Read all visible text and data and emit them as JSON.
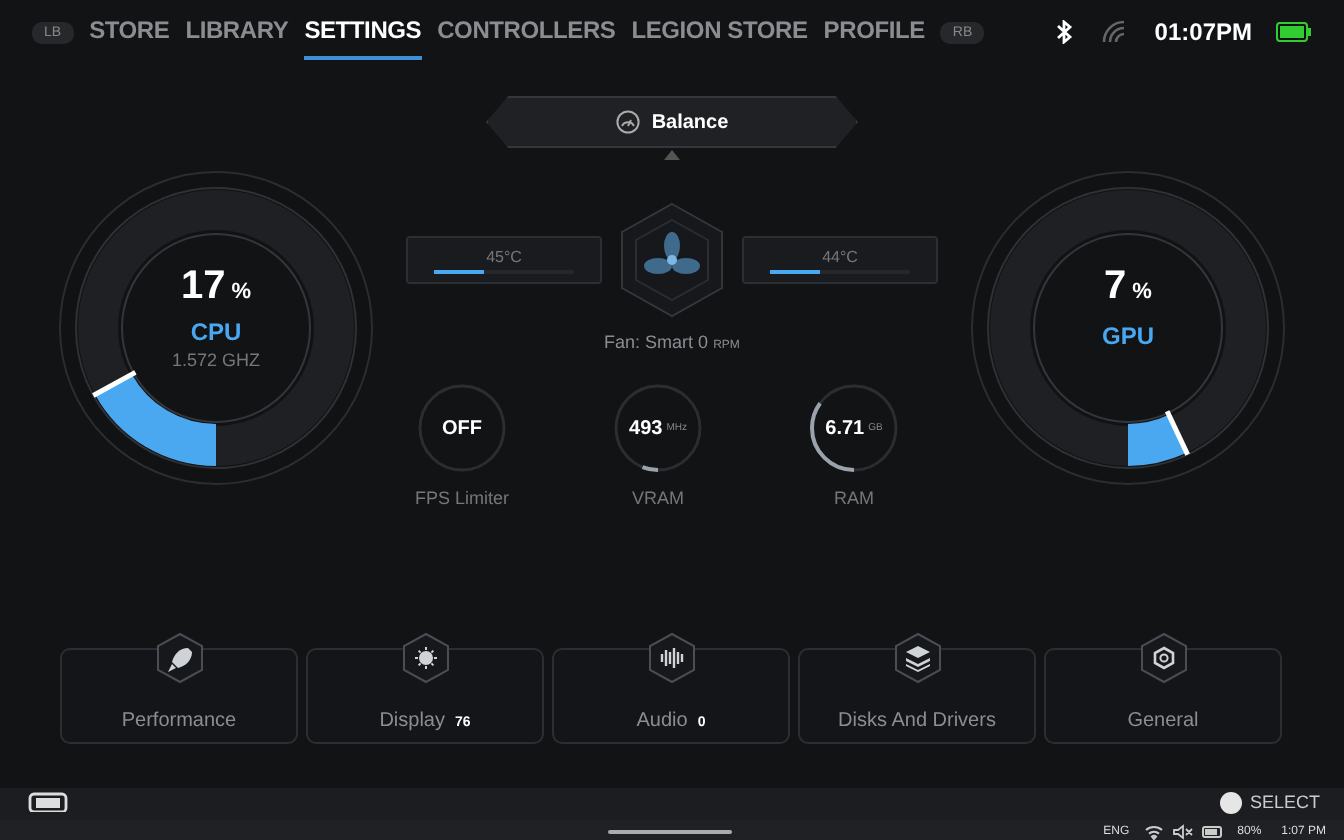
{
  "top_nav": {
    "left_bumper": "LB",
    "right_bumper": "RB",
    "time": "01:07PM",
    "tabs": [
      {
        "label": "STORE",
        "selected": false
      },
      {
        "label": "LIBRARY",
        "selected": false
      },
      {
        "label": "SETTINGS",
        "selected": true
      },
      {
        "label": "CONTROLLERS",
        "selected": false
      },
      {
        "label": "LEGION STORE",
        "selected": false
      },
      {
        "label": "PROFILE",
        "selected": false
      }
    ]
  },
  "performance_mode": "Balance",
  "cpu": {
    "value": "17",
    "unit": "%",
    "label": "CPU",
    "clock": "1.572 GHZ",
    "level": 0.17,
    "temperature": {
      "reading": "45°C",
      "level": 0.35
    }
  },
  "gpu": {
    "value": "7",
    "unit": "%",
    "label": "GPU",
    "level": 0.07,
    "temperature": {
      "reading": "44°C",
      "level": 0.35
    }
  },
  "fan": {
    "label": "Fan: Smart 0",
    "unit": "RPM"
  },
  "stats": [
    {
      "value": "OFF",
      "label": "FPS Limiter"
    },
    {
      "value": "493",
      "unit": "MHz",
      "label": "VRAM",
      "level": 0.06
    },
    {
      "value": "6.71",
      "unit": "GB",
      "label": "RAM",
      "level": 0.35
    }
  ],
  "categories": [
    {
      "label": "Performance"
    },
    {
      "label": "Display",
      "badge": "76"
    },
    {
      "label": "Audio",
      "badge": "0"
    },
    {
      "label": "Disks And Drivers"
    },
    {
      "label": "General"
    }
  ],
  "footer": {
    "action": "SELECT"
  },
  "taskbar": {
    "language": "ENG",
    "battery": "80%",
    "time": "1:07 PM"
  }
}
